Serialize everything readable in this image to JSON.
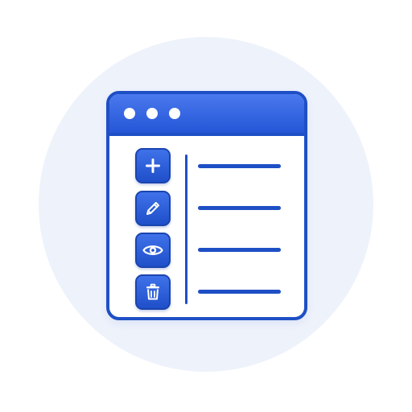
{
  "icons": {
    "window_controls": [
      "window-dot",
      "window-dot",
      "window-dot"
    ],
    "toolbar": [
      "plus-icon",
      "pencil-icon",
      "eye-icon",
      "trash-icon"
    ]
  },
  "list": {
    "rows": 4
  },
  "colors": {
    "accent": "#1e4fc4",
    "accent_light": "#4a78ee",
    "background_circle": "#eef2fb",
    "window_background": "#ffffff"
  }
}
